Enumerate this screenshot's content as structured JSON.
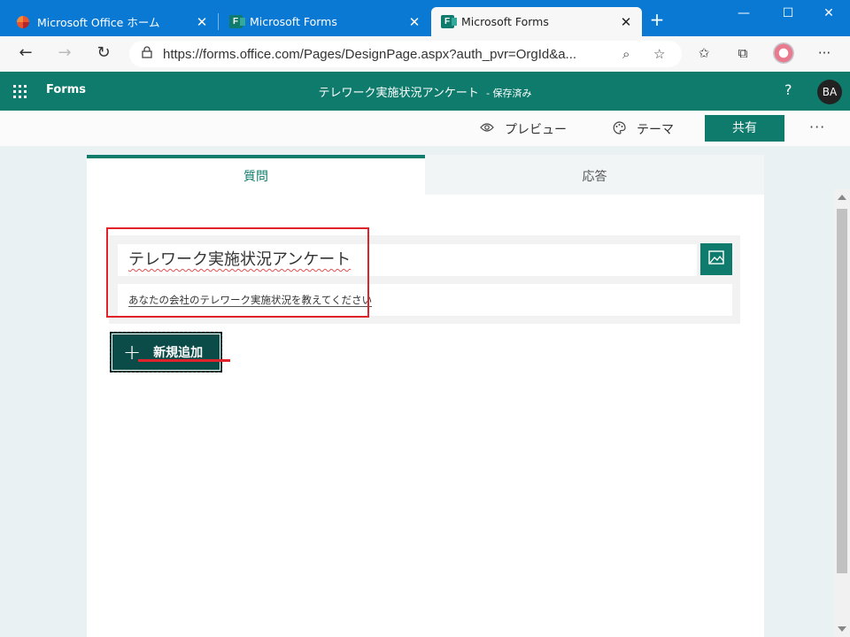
{
  "browser": {
    "tabs": [
      {
        "title": "Microsoft Office ホーム",
        "icon": "office-icon",
        "active": false
      },
      {
        "title": "Microsoft Forms",
        "icon": "forms-icon",
        "active": false
      },
      {
        "title": "Microsoft Forms",
        "icon": "forms-icon",
        "active": true
      }
    ],
    "close_glyph": "✕",
    "new_tab_glyph": "+",
    "window_controls": {
      "minimize": "—",
      "maximize": "☐",
      "close": "✕"
    },
    "address_bar": {
      "url": "https://forms.office.com/Pages/DesignPage.aspx?auth_pvr=OrgId&a...",
      "back_glyph": "←",
      "forward_glyph": "→",
      "refresh_glyph": "↻",
      "lock_glyph": "🔒"
    },
    "toolbar_glyphs": {
      "zoom": "⌕",
      "favorite": "☆",
      "favorites_list": "✩",
      "collections": "⧉",
      "more": "···"
    }
  },
  "forms_header": {
    "app_name": "Forms",
    "form_title": "テレワーク実施状況アンケート",
    "save_status": "- 保存済み",
    "help": "?",
    "user_initials": "BA"
  },
  "command_bar": {
    "preview_label": "プレビュー",
    "theme_label": "テーマ",
    "share_label": "共有",
    "more": "···"
  },
  "form_tabs": {
    "questions_label": "質問",
    "responses_label": "応答"
  },
  "form_editor": {
    "title_value": "テレワーク実施状況アンケート",
    "description_value": "あなたの会社のテレワーク実施状況を教えてください",
    "add_new_label": "新規追加",
    "add_new_glyph": "+"
  },
  "colors": {
    "edge_tabbar": "#0a79d4",
    "forms_accent": "#0f7b6c",
    "add_button": "#0b4b48",
    "annotation_red": "#e0232a"
  }
}
